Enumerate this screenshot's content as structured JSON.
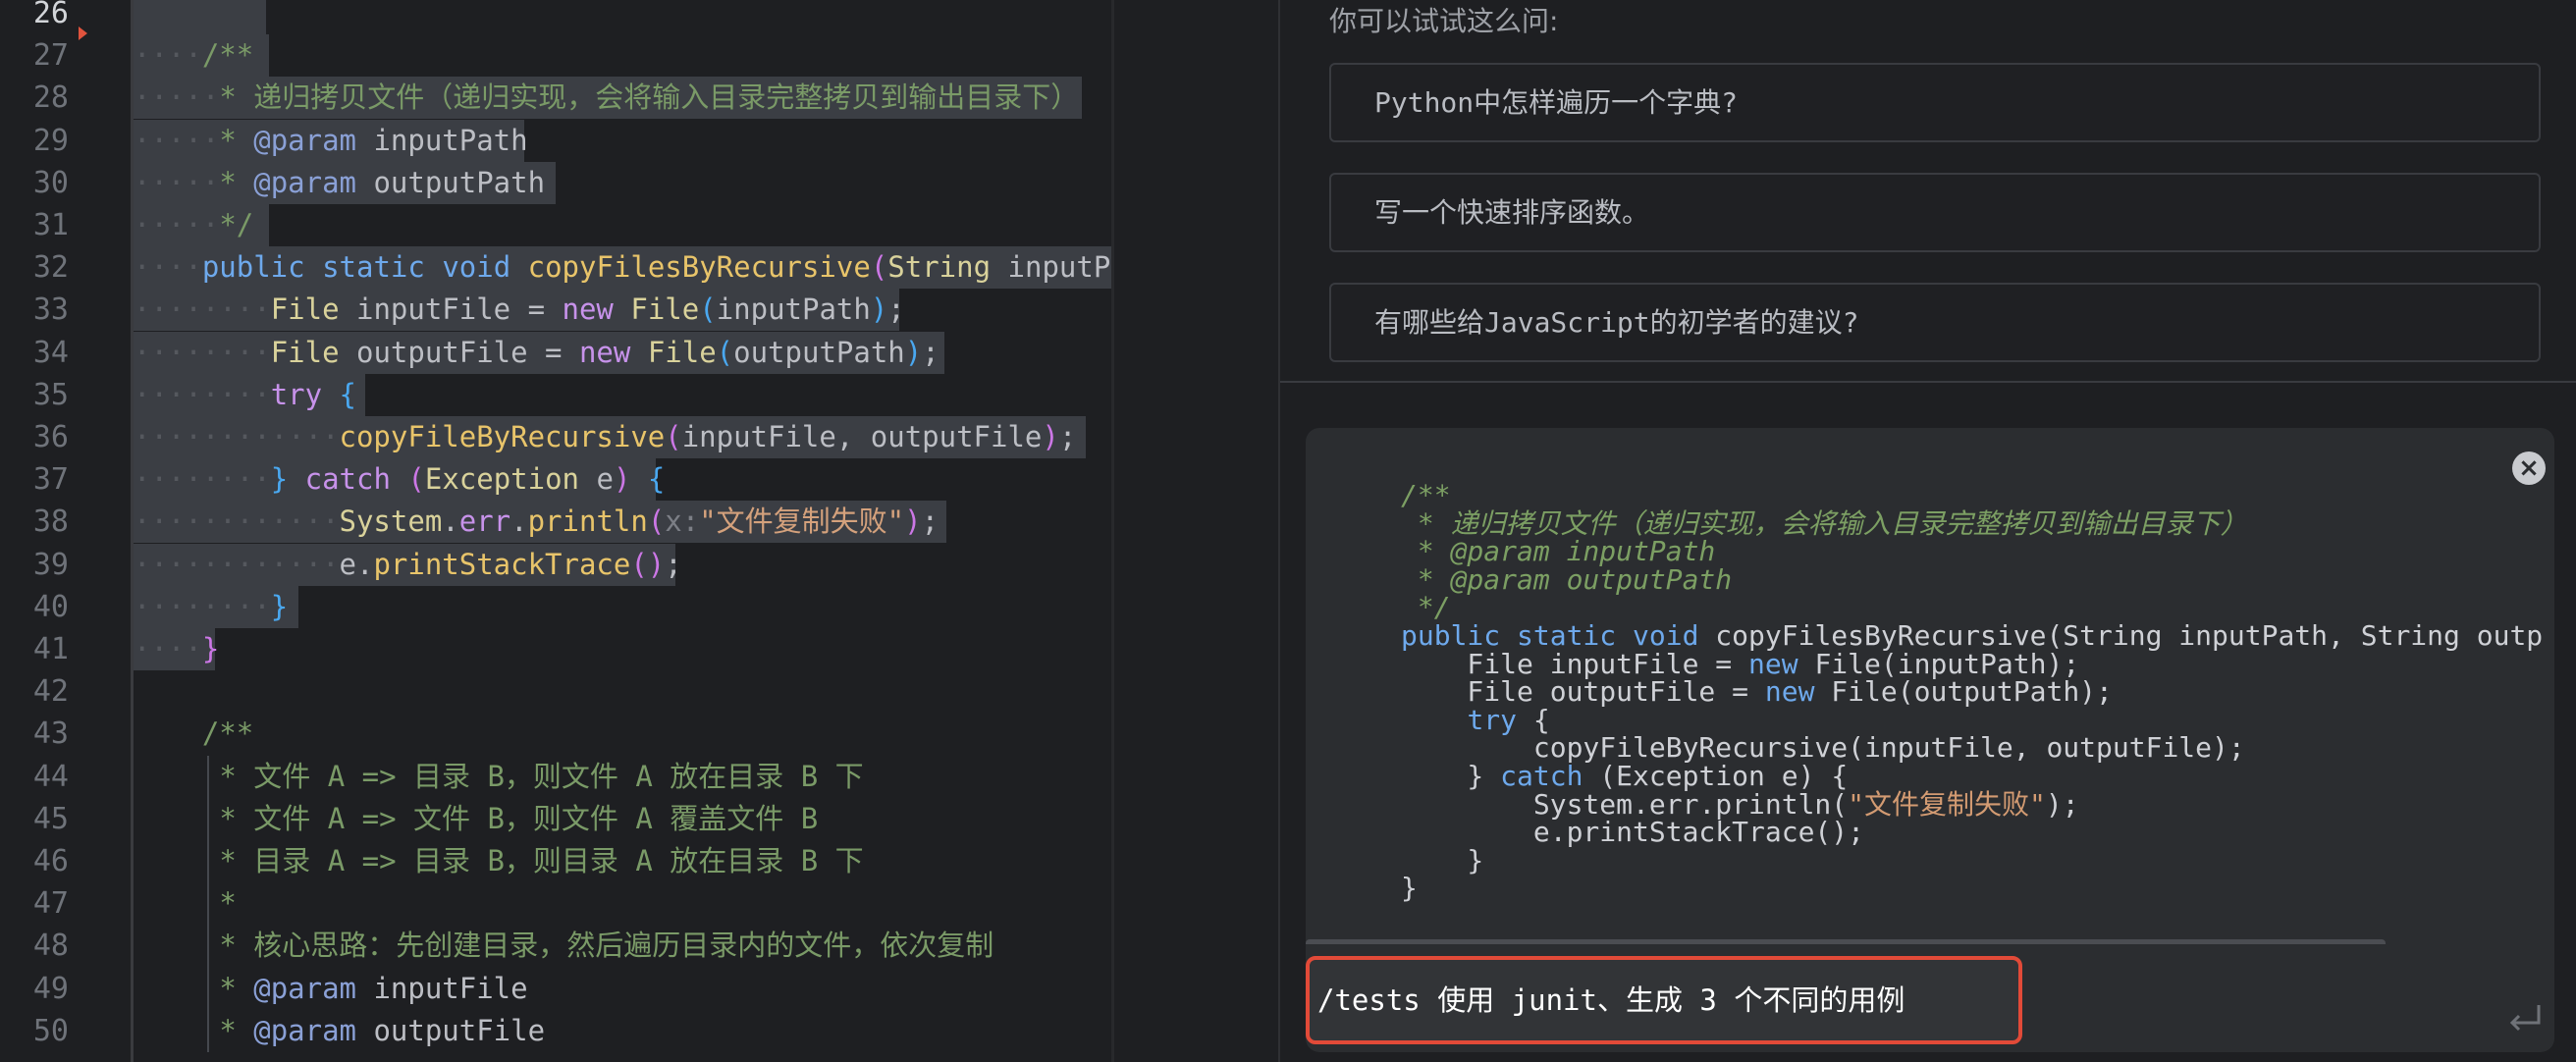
{
  "editor": {
    "lines": [
      {
        "n": "26",
        "current": true,
        "tokens": []
      },
      {
        "n": "27",
        "tokens": [
          [
            "ws",
            "····"
          ],
          [
            "cm",
            "/**"
          ]
        ]
      },
      {
        "n": "28",
        "tokens": [
          [
            "ws",
            "·····"
          ],
          [
            "cm",
            "* 递归拷贝文件（递归实现，会将输入目录完整拷贝到输出目录下）"
          ]
        ]
      },
      {
        "n": "29",
        "tokens": [
          [
            "ws",
            "·····"
          ],
          [
            "cm",
            "* "
          ],
          [
            "tag",
            "@param"
          ],
          [
            "plain",
            " inputPath"
          ]
        ]
      },
      {
        "n": "30",
        "tokens": [
          [
            "ws",
            "·····"
          ],
          [
            "cm",
            "* "
          ],
          [
            "tag",
            "@param"
          ],
          [
            "plain",
            " outputPath"
          ]
        ]
      },
      {
        "n": "31",
        "tokens": [
          [
            "ws",
            "·····"
          ],
          [
            "cm",
            "*/"
          ]
        ]
      },
      {
        "n": "32",
        "tokens": [
          [
            "ws",
            "····"
          ],
          [
            "kw2",
            "public"
          ],
          [
            "plain",
            " "
          ],
          [
            "kw2",
            "static"
          ],
          [
            "plain",
            " "
          ],
          [
            "kw2",
            "void"
          ],
          [
            "plain",
            " "
          ],
          [
            "fn",
            "copyFilesByRecursive"
          ],
          [
            "br1",
            "("
          ],
          [
            "cls",
            "String"
          ],
          [
            "plain",
            " inputPath"
          ]
        ]
      },
      {
        "n": "33",
        "tokens": [
          [
            "ws",
            "········"
          ],
          [
            "cls",
            "File"
          ],
          [
            "plain",
            " inputFile = "
          ],
          [
            "pk",
            "new"
          ],
          [
            "plain",
            " "
          ],
          [
            "cls",
            "File"
          ],
          [
            "br2",
            "("
          ],
          [
            "plain",
            "inputPath"
          ],
          [
            "br2",
            ")"
          ],
          [
            "plain",
            ";"
          ]
        ]
      },
      {
        "n": "34",
        "tokens": [
          [
            "ws",
            "········"
          ],
          [
            "cls",
            "File"
          ],
          [
            "plain",
            " outputFile = "
          ],
          [
            "pk",
            "new"
          ],
          [
            "plain",
            " "
          ],
          [
            "cls",
            "File"
          ],
          [
            "br2",
            "("
          ],
          [
            "plain",
            "outputPath"
          ],
          [
            "br2",
            ")"
          ],
          [
            "plain",
            ";"
          ]
        ]
      },
      {
        "n": "35",
        "tokens": [
          [
            "ws",
            "········"
          ],
          [
            "pk",
            "try"
          ],
          [
            "plain",
            " "
          ],
          [
            "br2",
            "{"
          ]
        ]
      },
      {
        "n": "36",
        "tokens": [
          [
            "ws",
            "············"
          ],
          [
            "fn",
            "copyFileByRecursive"
          ],
          [
            "br1",
            "("
          ],
          [
            "plain",
            "inputFile, outputFile"
          ],
          [
            "br1",
            ")"
          ],
          [
            "plain",
            ";"
          ]
        ]
      },
      {
        "n": "37",
        "tokens": [
          [
            "ws",
            "········"
          ],
          [
            "br2",
            "}"
          ],
          [
            "plain",
            " "
          ],
          [
            "pk",
            "catch"
          ],
          [
            "plain",
            " "
          ],
          [
            "br1",
            "("
          ],
          [
            "cls",
            "Exception"
          ],
          [
            "plain",
            " e"
          ],
          [
            "br1",
            ")"
          ],
          [
            "plain",
            " "
          ],
          [
            "br2",
            "{"
          ]
        ]
      },
      {
        "n": "38",
        "tokens": [
          [
            "ws",
            "············"
          ],
          [
            "cls",
            "System"
          ],
          [
            "plain",
            "."
          ],
          [
            "fld",
            "err"
          ],
          [
            "plain",
            "."
          ],
          [
            "fn",
            "println"
          ],
          [
            "br1",
            "("
          ],
          [
            "hint",
            "x:"
          ],
          [
            "str",
            "\"文件复制失败\""
          ],
          [
            "br1",
            ")"
          ],
          [
            "plain",
            ";"
          ]
        ]
      },
      {
        "n": "39",
        "tokens": [
          [
            "ws",
            "············"
          ],
          [
            "plain",
            "e."
          ],
          [
            "fn",
            "printStackTrace"
          ],
          [
            "br1",
            "()"
          ],
          [
            "plain",
            ";"
          ]
        ]
      },
      {
        "n": "40",
        "tokens": [
          [
            "ws",
            "········"
          ],
          [
            "br2",
            "}"
          ]
        ]
      },
      {
        "n": "41",
        "tokens": [
          [
            "ws",
            "····"
          ],
          [
            "br1",
            "}"
          ]
        ]
      },
      {
        "n": "42",
        "tokens": []
      },
      {
        "n": "43",
        "tokens": [
          [
            "plain",
            "    "
          ],
          [
            "cm",
            "/**"
          ]
        ]
      },
      {
        "n": "44",
        "tokens": [
          [
            "plain",
            "     "
          ],
          [
            "cm",
            "* 文件 A => 目录 B，则文件 A 放在目录 B 下"
          ]
        ]
      },
      {
        "n": "45",
        "tokens": [
          [
            "plain",
            "     "
          ],
          [
            "cm",
            "* 文件 A => 文件 B，则文件 A 覆盖文件 B"
          ]
        ]
      },
      {
        "n": "46",
        "tokens": [
          [
            "plain",
            "     "
          ],
          [
            "cm",
            "* 目录 A => 目录 B，则目录 A 放在目录 B 下"
          ]
        ]
      },
      {
        "n": "47",
        "tokens": [
          [
            "plain",
            "     "
          ],
          [
            "cm",
            "*"
          ]
        ]
      },
      {
        "n": "48",
        "tokens": [
          [
            "plain",
            "     "
          ],
          [
            "cm",
            "* 核心思路：先创建目录，然后遍历目录内的文件，依次复制"
          ]
        ]
      },
      {
        "n": "49",
        "tokens": [
          [
            "plain",
            "     "
          ],
          [
            "cm",
            "* "
          ],
          [
            "tag",
            "@param"
          ],
          [
            "plain",
            " inputFile"
          ]
        ]
      },
      {
        "n": "50",
        "tokens": [
          [
            "plain",
            "     "
          ],
          [
            "cm",
            "* "
          ],
          [
            "tag",
            "@param"
          ],
          [
            "plain",
            " outputFile"
          ]
        ]
      }
    ]
  },
  "assistant": {
    "suggestions_heading": "你可以试试这么问:",
    "suggestions": [
      "Python中怎样遍历一个字典?",
      "写一个快速排序函数。",
      "有哪些给JavaScript的初学者的建议?"
    ],
    "snippet_lines": [
      [
        [
          "ccm",
          "/**"
        ]
      ],
      [
        [
          "ccm",
          " * 递归拷贝文件（递归实现，会将输入目录完整拷贝到输出目录下）"
        ]
      ],
      [
        [
          "ccm",
          " * @param inputPath"
        ]
      ],
      [
        [
          "ccm",
          " * @param outputPath"
        ]
      ],
      [
        [
          "ccm",
          " */"
        ]
      ],
      [
        [
          "ckw",
          "public static void"
        ],
        [
          "p",
          " copyFilesByRecursive(String inputPath, String outp"
        ]
      ],
      [
        [
          "p",
          "    File inputFile = "
        ],
        [
          "ckw",
          "new"
        ],
        [
          "p",
          " File(inputPath);"
        ]
      ],
      [
        [
          "p",
          "    File outputFile = "
        ],
        [
          "ckw",
          "new"
        ],
        [
          "p",
          " File(outputPath);"
        ]
      ],
      [
        [
          "p",
          "    "
        ],
        [
          "ckw",
          "try"
        ],
        [
          "p",
          " {"
        ]
      ],
      [
        [
          "p",
          "        copyFileByRecursive(inputFile, outputFile);"
        ]
      ],
      [
        [
          "p",
          "    } "
        ],
        [
          "ckw",
          "catch"
        ],
        [
          "p",
          " (Exception e) {"
        ]
      ],
      [
        [
          "p",
          "        System.err.println("
        ],
        [
          "cstr",
          "\"文件复制失败\""
        ],
        [
          "p",
          ");"
        ]
      ],
      [
        [
          "p",
          "        e.printStackTrace();"
        ]
      ],
      [
        [
          "p",
          "    }"
        ]
      ],
      [
        [
          "p",
          "}"
        ]
      ]
    ],
    "close_label": "×",
    "input_value": "/tests 使用 junit、生成 3 个不同的用例"
  },
  "icons": {
    "close": "close-icon",
    "send": "enter-icon",
    "breakpoint": "run-marker-icon"
  },
  "colors": {
    "accent_outline": "#e24a38",
    "comment": "#7a9a67",
    "keyword": "#6ea9ec"
  }
}
